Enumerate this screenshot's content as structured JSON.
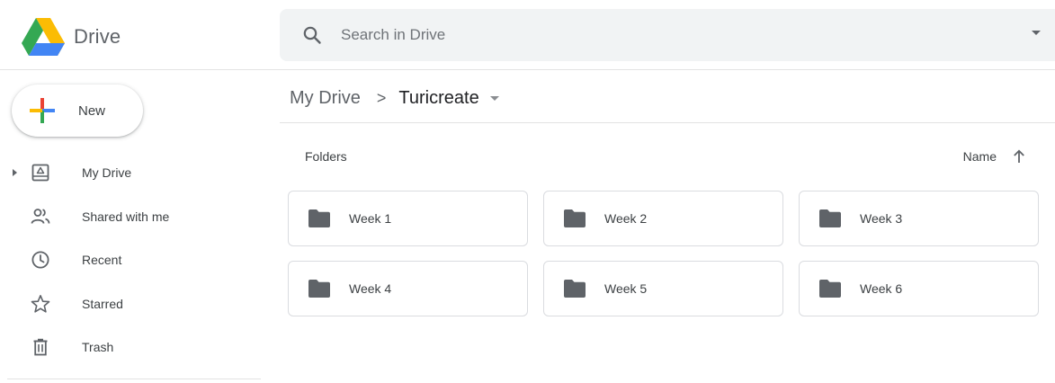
{
  "header": {
    "app_name": "Drive",
    "search_placeholder": "Search in Drive"
  },
  "sidebar": {
    "new_label": "New",
    "items": [
      {
        "label": "My Drive",
        "icon": "my-drive-icon",
        "expandable": true
      },
      {
        "label": "Shared with me",
        "icon": "shared-icon"
      },
      {
        "label": "Recent",
        "icon": "clock-icon"
      },
      {
        "label": "Starred",
        "icon": "star-icon"
      },
      {
        "label": "Trash",
        "icon": "trash-icon"
      }
    ]
  },
  "breadcrumb": {
    "root": "My Drive",
    "separator": ">",
    "current": "Turicreate"
  },
  "content": {
    "section_title": "Folders",
    "sort_label": "Name",
    "sort_direction": "ascending",
    "folders": [
      {
        "name": "Week 1"
      },
      {
        "name": "Week 2"
      },
      {
        "name": "Week 3"
      },
      {
        "name": "Week 4"
      },
      {
        "name": "Week 5"
      },
      {
        "name": "Week 6"
      }
    ]
  },
  "colors": {
    "google_blue": "#4285f4",
    "google_red": "#ea4335",
    "google_yellow": "#fbbc04",
    "google_green": "#34a853",
    "icon_grey": "#5f6368",
    "folder_grey": "#5f6368"
  }
}
